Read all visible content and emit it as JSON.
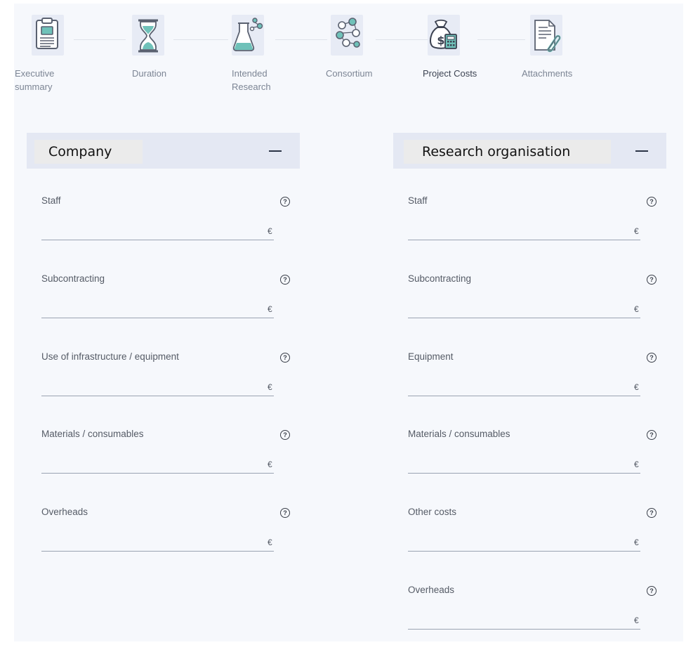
{
  "stepper": {
    "steps": [
      {
        "label_lines": [
          "Executive",
          "summary"
        ],
        "icon": "clipboard-icon"
      },
      {
        "label_lines": [
          "Duration"
        ],
        "icon": "hourglass-icon"
      },
      {
        "label_lines": [
          "Intended",
          "Research"
        ],
        "icon": "flask-icon"
      },
      {
        "label_lines": [
          "Consortium"
        ],
        "icon": "people-network-icon"
      },
      {
        "label_lines": [
          "Project Costs"
        ],
        "icon": "money-bag-calculator-icon",
        "active": true
      },
      {
        "label_lines": [
          "Attachments"
        ],
        "icon": "document-paperclip-icon"
      }
    ]
  },
  "company": {
    "title": "Company",
    "collapse_symbol": "—",
    "fields": [
      {
        "label": "Staff",
        "value": "",
        "currency": "€"
      },
      {
        "label": "Subcontracting",
        "value": "",
        "currency": "€"
      },
      {
        "label": "Use of infrastructure / equipment",
        "value": "",
        "currency": "€"
      },
      {
        "label": "Materials / consumables",
        "value": "",
        "currency": "€"
      },
      {
        "label": "Overheads",
        "value": "",
        "currency": "€"
      }
    ]
  },
  "research": {
    "title": "Research organisation",
    "fields": [
      {
        "label": "Staff",
        "value": "",
        "currency": "€"
      },
      {
        "label": "Subcontracting",
        "value": "",
        "currency": "€"
      },
      {
        "label": "Equipment",
        "value": "",
        "currency": "€"
      },
      {
        "label": "Materials / consumables",
        "value": "",
        "currency": "€"
      },
      {
        "label": "Other costs",
        "value": "",
        "currency": "€"
      },
      {
        "label": "Overheads",
        "value": "",
        "currency": "€"
      }
    ]
  },
  "help_glyph": "?",
  "colors": {
    "page_bg": "#f6f8fc",
    "header_bg": "#e4e8f3",
    "icon_teal": "#6fc1b9",
    "icon_stroke": "#5a6170",
    "underline": "#9aa3b2"
  }
}
